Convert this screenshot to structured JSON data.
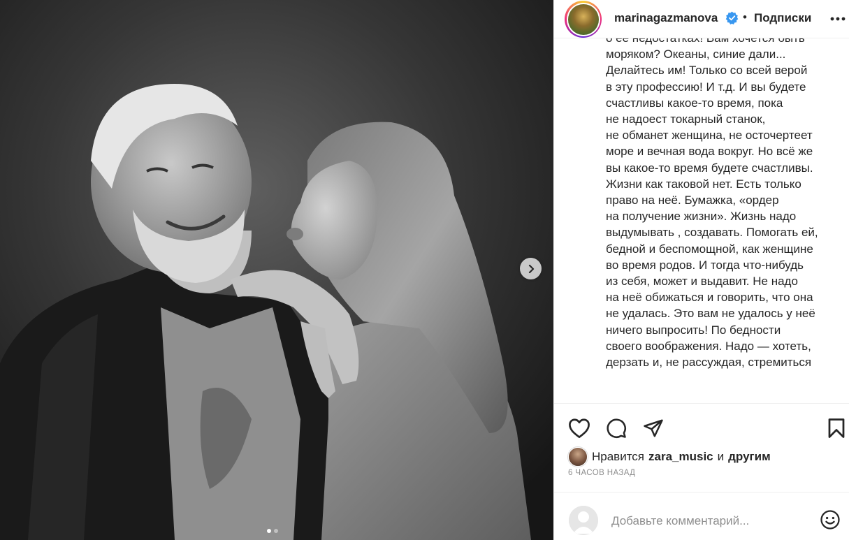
{
  "post": {
    "author": "marinagazmanova",
    "separator": "•",
    "follow_label": "Подписки",
    "caption": "о её недостатках! Вам хочется быть\nморяком? Океаны, синие дали...\nДелайтесь им! Только со всей верой\nв эту профессию! И т.д. И вы будете\nсчастливы какое-то время, пока\nне надоест токарный станок,\nне обманет женщина, не осточертеет\nморе и вечная вода вокруг. Но всё же\nвы какое-то время будете счастливы.\nЖизни как таковой нет. Есть только\nправо на неё. Бумажка, «ордер\nна получение жизни». Жизнь надо\nвыдумывать , создавать. Помогать ей,\nбедной и беспомощной, как женщине\nво время родов. И тогда что-нибудь\nиз себя, может и выдавит. Не надо\nна неё обижаться и говорить, что она\nне удалась. Это вам не удалось у неё\nничего выпросить! По бедности\nсвоего воображения. Надо — хотеть,\nдерзать и, не рассуждая, стремиться",
    "carousel": {
      "current": 1,
      "total": 2
    }
  },
  "likes": {
    "prefix": "Нравится",
    "user": "zara_music",
    "conjunction": "и",
    "suffix": "другим"
  },
  "timestamp": "6 ЧАСОВ НАЗАД",
  "comment": {
    "placeholder": "Добавьте комментарий..."
  },
  "icons": {
    "verified": "verified-badge-icon",
    "more": "more-options-icon",
    "next": "chevron-right-icon",
    "like": "heart-icon",
    "comment": "comment-icon",
    "share": "paper-plane-icon",
    "save": "bookmark-icon",
    "emoji": "emoji-icon"
  },
  "colors": {
    "text": "#262626",
    "muted": "#8e8e8e",
    "verified": "#3897f0",
    "border": "#efefef"
  }
}
